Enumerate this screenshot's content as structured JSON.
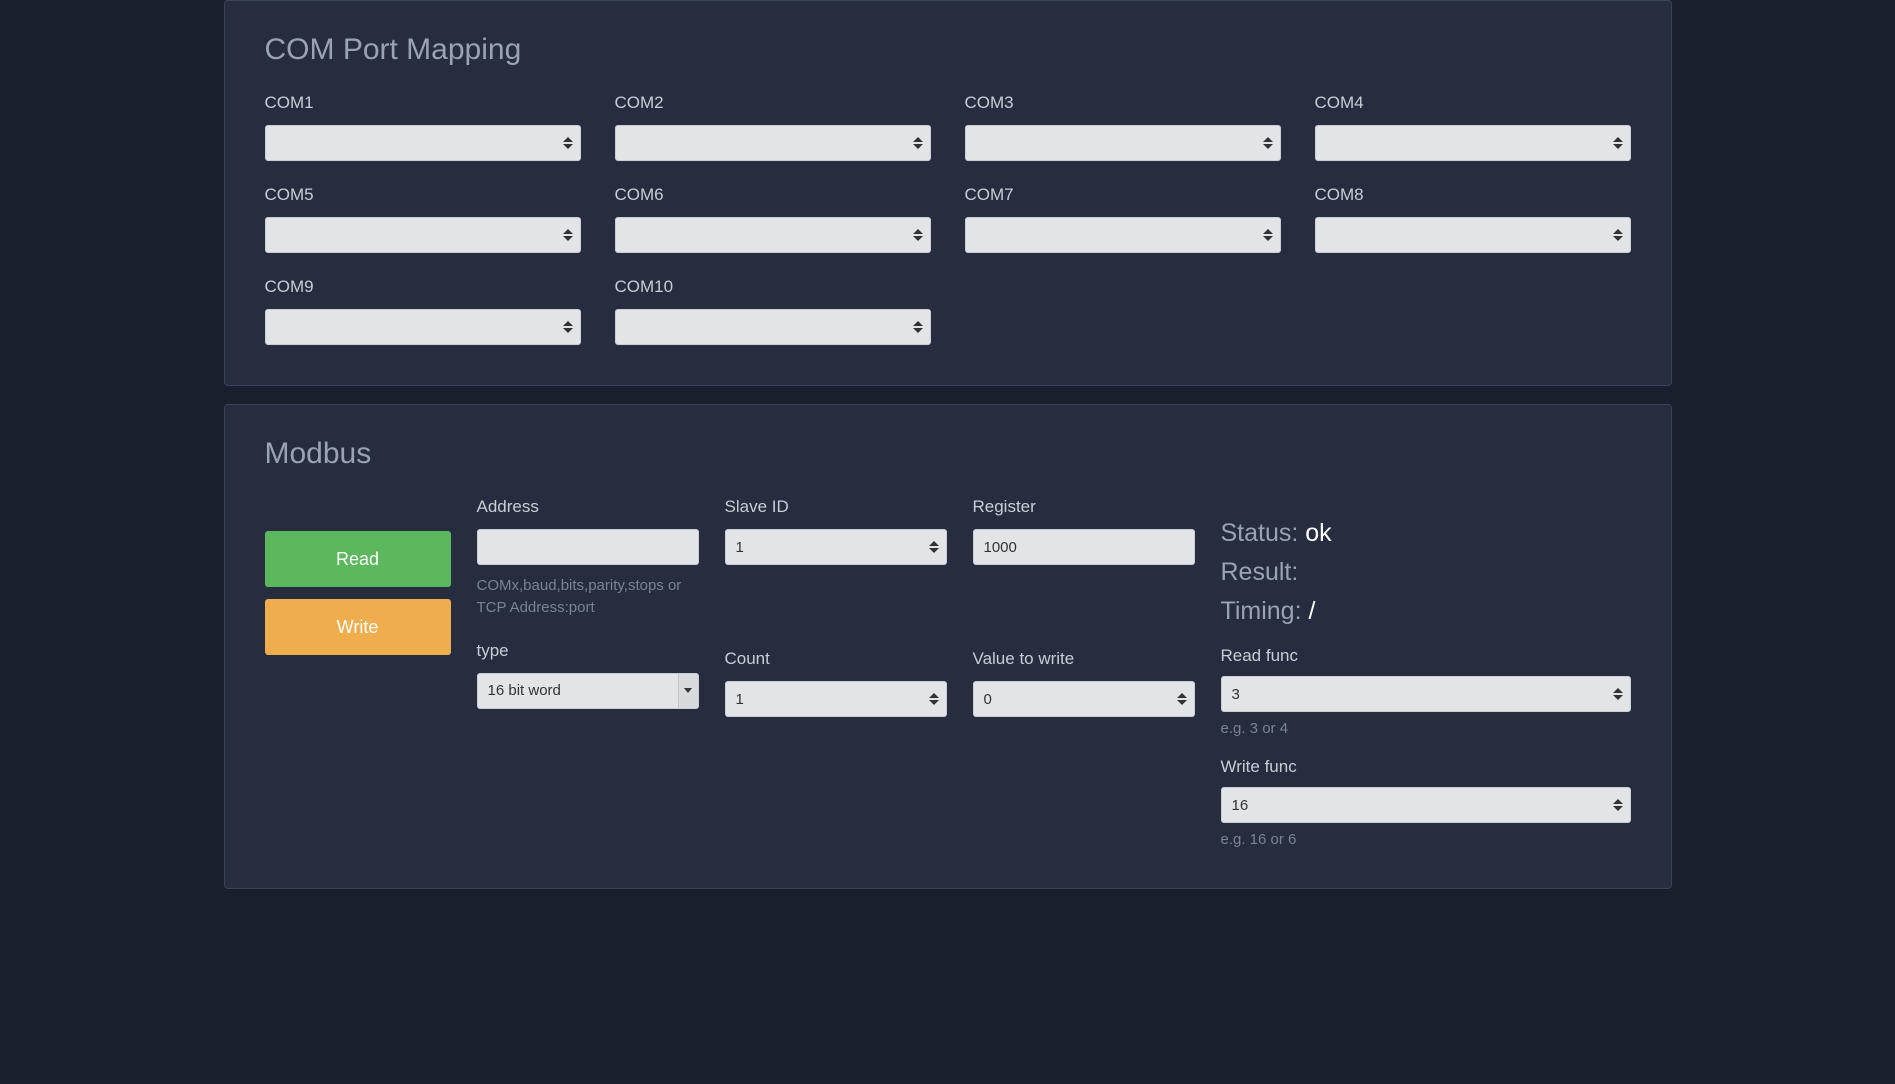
{
  "com_mapping": {
    "title": "COM Port Mapping",
    "ports": [
      {
        "label": "COM1",
        "value": ""
      },
      {
        "label": "COM2",
        "value": ""
      },
      {
        "label": "COM3",
        "value": ""
      },
      {
        "label": "COM4",
        "value": ""
      },
      {
        "label": "COM5",
        "value": ""
      },
      {
        "label": "COM6",
        "value": ""
      },
      {
        "label": "COM7",
        "value": ""
      },
      {
        "label": "COM8",
        "value": ""
      },
      {
        "label": "COM9",
        "value": ""
      },
      {
        "label": "COM10",
        "value": ""
      }
    ]
  },
  "modbus": {
    "title": "Modbus",
    "buttons": {
      "read": "Read",
      "write": "Write"
    },
    "fields": {
      "address": {
        "label": "Address",
        "value": "",
        "help": "COMx,baud,bits,parity,stops or TCP Address:port"
      },
      "slave_id": {
        "label": "Slave ID",
        "value": "1"
      },
      "register": {
        "label": "Register",
        "value": "1000"
      },
      "type": {
        "label": "type",
        "value": "16 bit word"
      },
      "count": {
        "label": "Count",
        "value": "1"
      },
      "value_to_write": {
        "label": "Value to write",
        "value": "0"
      }
    },
    "status": {
      "status_label": "Status: ",
      "status_value": "ok",
      "result_label": "Result:",
      "result_value": "",
      "timing_label": "Timing: ",
      "timing_value": "/"
    },
    "funcs": {
      "read_func": {
        "label": "Read func",
        "value": "3",
        "help": "e.g. 3 or 4"
      },
      "write_func": {
        "label": "Write func",
        "value": "16",
        "help": "e.g. 16 or 6"
      }
    }
  }
}
